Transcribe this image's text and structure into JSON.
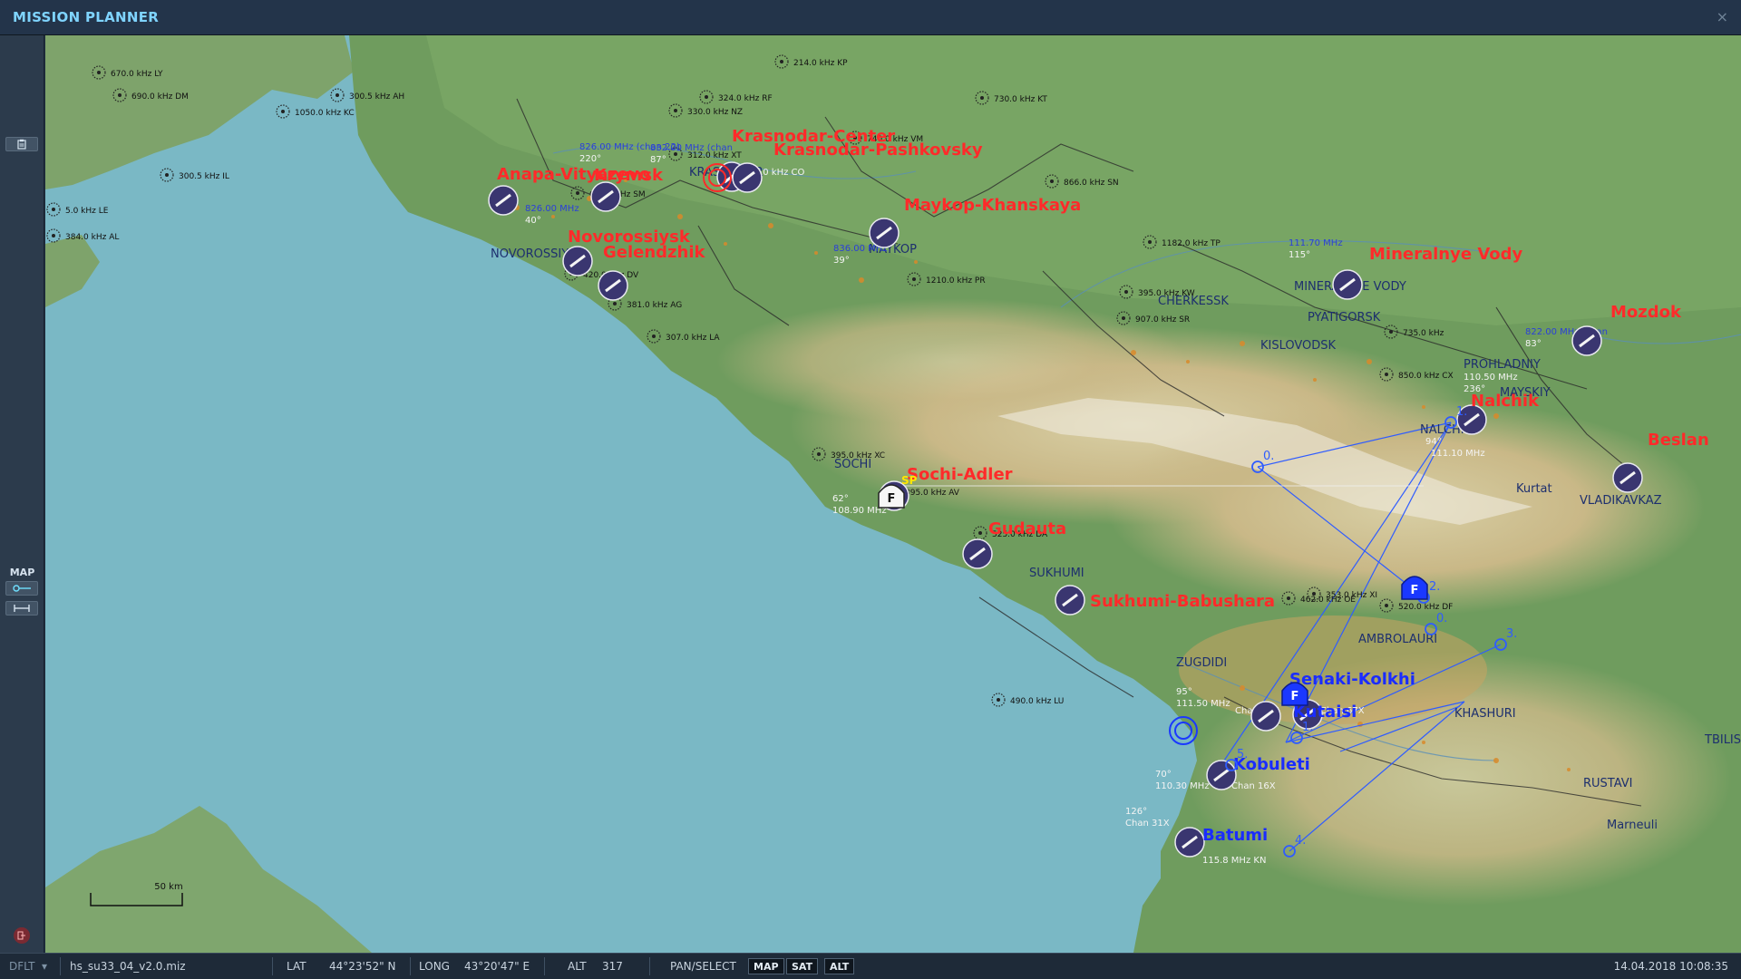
{
  "window": {
    "title": "MISSION PLANNER",
    "close_glyph": "×"
  },
  "sidebar": {
    "map_label": "MAP",
    "top_icon": "clipboard-icon",
    "exit_icon": "exit-icon"
  },
  "map": {
    "airfields": [
      {
        "name": "Anapa-Vityazevo",
        "color": "#ff2a2a"
      },
      {
        "name": "Krymsk",
        "color": "#ff2a2a"
      },
      {
        "name": "Krasnodar-Center",
        "color": "#ff2a2a"
      },
      {
        "name": "Krasnodar-Pashkovsky",
        "color": "#ff2a2a"
      },
      {
        "name": "Maykop-Khanskaya",
        "color": "#ff2a2a"
      },
      {
        "name": "Novorossiysk",
        "color": "#ff2a2a"
      },
      {
        "name": "Gelendzhik",
        "color": "#ff2a2a"
      },
      {
        "name": "Mineralnye Vody",
        "color": "#ff2a2a"
      },
      {
        "name": "Mozdok",
        "color": "#ff2a2a"
      },
      {
        "name": "Nalchik",
        "color": "#ff2a2a"
      },
      {
        "name": "Beslan",
        "color": "#ff2a2a"
      },
      {
        "name": "Sochi-Adler",
        "color": "#ff2a2a"
      },
      {
        "name": "Gudauta",
        "color": "#ff2a2a"
      },
      {
        "name": "Sukhumi-Babushara",
        "color": "#ff2a2a"
      },
      {
        "name": "Senaki-Kolkhi",
        "color": "#1a2cff"
      },
      {
        "name": "Kutaisi",
        "color": "#1a2cff"
      },
      {
        "name": "Kobuleti",
        "color": "#1a2cff"
      },
      {
        "name": "Batumi",
        "color": "#1a2cff"
      }
    ],
    "towns": [
      "NOVOROSSIYSK",
      "KRASNODAR",
      "MAYKOP",
      "SOCHI",
      "SUKHUMI",
      "CHERKESSK",
      "MINERALNYE VODY",
      "PYATIGORSK",
      "KISLOVODSK",
      "PROHLADNIY",
      "MAYSKIY",
      "NALCHIK",
      "VLADIKAVKAZ",
      "ZUGDIDI",
      "AMBROLAURI",
      "KHASHURI",
      "Kurtat",
      "Marneuli",
      "RUSTAVI",
      "TBILISI"
    ],
    "ndbs": [
      "670.0 kHz LY",
      "690.0 kHz DM",
      "1050.0 kHz KC",
      "300.5 kHz AH",
      "300.5 kHz IL",
      "384.0 kHz AL",
      "214.0 kHz KP",
      "324.0 kHz RF",
      "330.0 kHz NZ",
      "312.0 kHz XT",
      "730.0 kHz KT",
      "740.0 kHz VM",
      "866.0 kHz SN",
      "662.0 kHz SM",
      "420.0 kHz DV",
      "381.0 kHz AG",
      "307.0 kHz LA",
      "1210.0 kHz PR",
      "1182.0 kHz TP",
      "395.0 kHz KW",
      "907.0 kHz SR",
      "735.0 kHz",
      "395.0 kHz XC",
      "395.0 kHz AV",
      "525.0 kHz DA",
      "353.0 kHz XI",
      "462.0 kHz OE",
      "520.0 kHz DF",
      "490.0 kHz LU",
      "5.0 kHz LE",
      "850.0 kHz CX"
    ],
    "freqs": [
      "826.00 MHz (chan 22)",
      "220°",
      "826.00 MHz",
      "40°",
      "832.00 MHz (chan",
      "87°",
      "836.00 MHz",
      "39°",
      "111.70 MHz",
      "115°",
      "822.00 MHz (chan",
      "83°",
      "110.50 MHz",
      "236°",
      "94°",
      "111.10 MHz",
      "62°",
      "108.90 MHz",
      "95°",
      "111.50 MHz",
      "70°",
      "110.30 MHz",
      "126°",
      "Chan 31X",
      "Chan 44X",
      "Chan 67X",
      "Chan 16X",
      "115.8 MHz KN",
      "118.0 kHz CO"
    ],
    "waypoints": [
      "0.",
      "1.",
      "2.",
      "3.",
      "4.",
      "5.",
      "0.",
      "1."
    ],
    "scale_label": "50 km",
    "sp_label": "SP",
    "ac_letter": "F"
  },
  "status": {
    "profile": "DFLT",
    "mission_file": "hs_su33_04_v2.0.miz",
    "lat_label": "LAT",
    "lat_value": "44°23'52\" N",
    "long_label": "LONG",
    "long_value": "43°20'47\" E",
    "alt_label": "ALT",
    "alt_value": "317",
    "pan_select": "PAN/SELECT",
    "btn_map": "MAP",
    "btn_sat": "SAT",
    "btn_alt": "ALT",
    "datetime": "14.04.2018 10:08:35"
  }
}
